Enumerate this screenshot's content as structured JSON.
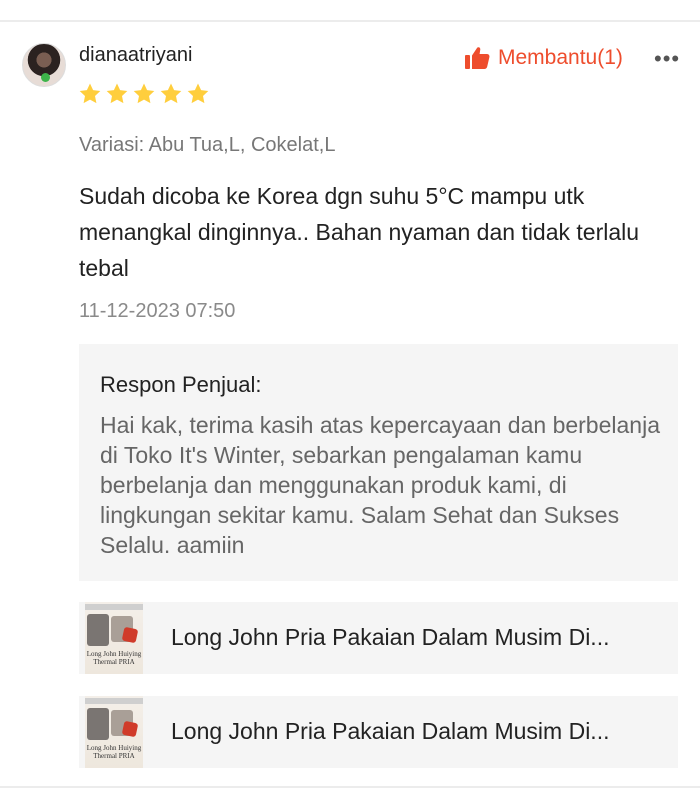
{
  "review": {
    "username": "dianaatriyani",
    "rating": 5,
    "helpful_label": "Membantu(1)",
    "more_label": "•••",
    "variant": "Variasi: Abu Tua,L, Cokelat,L",
    "comment": "Sudah dicoba ke Korea dgn suhu 5°C mampu utk menangkal dinginnya.. Bahan nyaman dan tidak terlalu tebal",
    "timestamp": "11-12-2023 07:50"
  },
  "seller_response": {
    "title": "Respon Penjual:",
    "text": "Hai kak, terima kasih atas kepercayaan dan berbelanja di Toko It's Winter, sebarkan pengalaman kamu berbelanja dan menggunakan produk kami, di lingkungan sekitar kamu. Salam Sehat dan Sukses Selalu. aamiin"
  },
  "products": [
    {
      "title": "Long John Pria Pakaian Dalam Musim Di...",
      "thumb_caption": "Long John Huiying Thermal PRIA"
    },
    {
      "title": "Long John Pria Pakaian Dalam Musim Di...",
      "thumb_caption": "Long John Huiying Thermal PRIA"
    }
  ],
  "colors": {
    "accent": "#ee4d2d",
    "star": "#ffce3d",
    "panel_bg": "#f5f5f5"
  },
  "icons": {
    "avatar": "user-avatar",
    "star": "star-icon",
    "helpful": "thumbs-up-icon",
    "more": "more-options-icon"
  }
}
